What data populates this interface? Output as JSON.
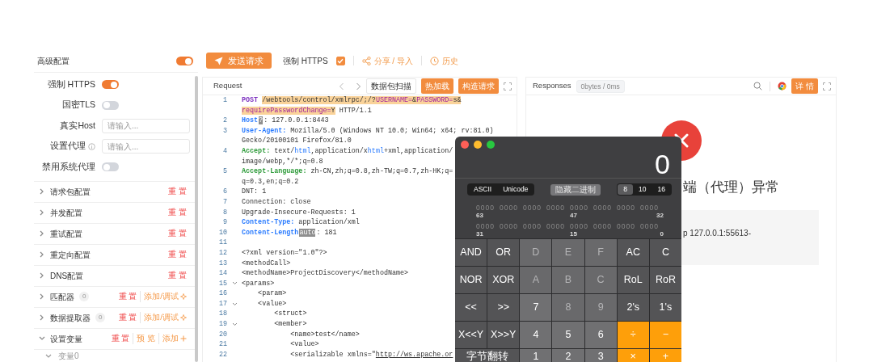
{
  "sidebar": {
    "title": "高级配置",
    "enabled": true,
    "fields": [
      {
        "kind": "toggle",
        "label": "强制 HTTPS",
        "on": true
      },
      {
        "kind": "toggle",
        "label": "国密TLS",
        "on": false
      },
      {
        "kind": "input",
        "label": "真实Host",
        "placeholder": "请输入..."
      },
      {
        "kind": "input",
        "label": "设置代理",
        "hint_icon": true,
        "placeholder": "请输入..."
      },
      {
        "kind": "toggle",
        "label": "禁用系统代理",
        "on": false
      }
    ],
    "sections": [
      {
        "label": "请求包配置",
        "expanded": false,
        "actions": [
          {
            "kind": "reset",
            "label": "重 置"
          }
        ]
      },
      {
        "label": "并发配置",
        "expanded": false,
        "actions": [
          {
            "kind": "reset",
            "label": "重 置"
          }
        ]
      },
      {
        "label": "重试配置",
        "expanded": false,
        "actions": [
          {
            "kind": "reset",
            "label": "重 置"
          }
        ]
      },
      {
        "label": "重定向配置",
        "expanded": false,
        "actions": [
          {
            "kind": "reset",
            "label": "重 置"
          }
        ]
      },
      {
        "label": "DNS配置",
        "expanded": false,
        "actions": [
          {
            "kind": "reset",
            "label": "重 置"
          }
        ]
      },
      {
        "label": "匹配器",
        "count": "0",
        "expanded": false,
        "actions": [
          {
            "kind": "reset",
            "label": "重 置"
          },
          {
            "kind": "debug",
            "label": "添加/调试"
          }
        ]
      },
      {
        "label": "数据提取器",
        "count": "0",
        "expanded": false,
        "actions": [
          {
            "kind": "reset",
            "label": "重 置"
          },
          {
            "kind": "debug",
            "label": "添加/调试"
          }
        ]
      },
      {
        "label": "设置变量",
        "expanded": true,
        "actions": [
          {
            "kind": "reset",
            "label": "重 置"
          },
          {
            "kind": "preview",
            "label": "预 览"
          },
          {
            "kind": "add",
            "label": "添加"
          }
        ],
        "children": [
          {
            "label": "变量0",
            "expanded": true
          }
        ]
      }
    ]
  },
  "toolbar": {
    "send_button": "发送请求",
    "force_https": {
      "label": "强制 HTTPS",
      "checked": true
    },
    "share": "分享 / 导入",
    "history": "历史"
  },
  "request": {
    "title": "Request",
    "scan_button": "数据包扫描",
    "buttons": [
      "热加载",
      "构造请求"
    ],
    "lines": [
      {
        "number": "1",
        "rows": [
          {
            "segments": [
              {
                "text": "POST ",
                "kind": "method"
              },
              {
                "text": "/webtools/control/xmlrpc/;/?",
                "kind": "mark"
              },
              {
                "text": "USERNAME=",
                "kind": "param"
              },
              {
                "text": "&",
                "kind": "mark"
              },
              {
                "text": "PASSWORD=",
                "kind": "param"
              },
              {
                "text": "s&",
                "kind": "mark"
              }
            ]
          },
          {
            "segments": [
              {
                "text": "requirePasswordChange=",
                "kind": "param"
              },
              {
                "text": "Y",
                "kind": "mark"
              },
              {
                "text": " HTTP/1.1"
              }
            ]
          }
        ]
      },
      {
        "number": "2",
        "rows": [
          {
            "segments": [
              {
                "text": "Host",
                "kind": "key"
              },
              {
                "text": "?",
                "kind": "hint"
              },
              {
                "text": ": 127.0.0.1:8443"
              }
            ]
          }
        ]
      },
      {
        "number": "3",
        "rows": [
          {
            "segments": [
              {
                "text": "User-Agent:",
                "kind": "key"
              },
              {
                "text": " Mozilla/5.0 (Windows NT 10.0; Win64; x64; rv:81.0)"
              }
            ]
          },
          {
            "segments": [
              {
                "text": "Gecko/20100101 Firefox/81.0"
              }
            ]
          }
        ]
      },
      {
        "number": "4",
        "rows": [
          {
            "segments": [
              {
                "text": "Accept:",
                "kind": "accept"
              },
              {
                "text": " text/"
              },
              {
                "text": "html",
                "kind": "type"
              },
              {
                "text": ",application/x"
              },
              {
                "text": "html",
                "kind": "type"
              },
              {
                "text": "+xml,application/"
              }
            ]
          },
          {
            "segments": [
              {
                "text": "image/webp,*/*;q=0.8"
              }
            ]
          }
        ]
      },
      {
        "number": "5",
        "rows": [
          {
            "segments": [
              {
                "text": "Accept-Language:",
                "kind": "accept"
              },
              {
                "text": " zh-CN,zh;q=0.8,zh-TW;q=0.7,zh-HK;q="
              }
            ]
          },
          {
            "segments": [
              {
                "text": "q=0.3,en;q=0.2"
              }
            ]
          }
        ]
      },
      {
        "number": "6",
        "rows": [
          {
            "segments": [
              {
                "text": "DNT: 1"
              }
            ]
          }
        ]
      },
      {
        "number": "7",
        "rows": [
          {
            "segments": [
              {
                "text": "Connection: close"
              }
            ]
          }
        ]
      },
      {
        "number": "8",
        "rows": [
          {
            "segments": [
              {
                "text": "Upgrade-Insecure-Requests: 1"
              }
            ]
          }
        ]
      },
      {
        "number": "9",
        "rows": [
          {
            "segments": [
              {
                "text": "Content-Type:",
                "kind": "key"
              },
              {
                "text": " application/xml"
              }
            ]
          }
        ]
      },
      {
        "number": "10",
        "rows": [
          {
            "segments": [
              {
                "text": "Content-Length",
                "kind": "key"
              },
              {
                "text": "auto",
                "kind": "hint"
              },
              {
                "text": ": 181"
              }
            ]
          }
        ]
      },
      {
        "number": "11"
      },
      {
        "number": "12",
        "rows": [
          {
            "segments": [
              {
                "text": "<?xml version=\"1.0\"?>"
              }
            ]
          }
        ]
      },
      {
        "number": "13",
        "rows": [
          {
            "segments": [
              {
                "text": "<methodCall>"
              }
            ]
          }
        ]
      },
      {
        "number": "14",
        "rows": [
          {
            "segments": [
              {
                "text": "<methodName>ProjectDiscovery</methodName>"
              }
            ]
          }
        ]
      },
      {
        "number": "15",
        "expanded": true,
        "rows": [
          {
            "segments": [
              {
                "text": "<params>"
              }
            ]
          }
        ]
      },
      {
        "number": "16",
        "rows": [
          {
            "segments": [
              {
                "text": "    <param>"
              }
            ]
          }
        ]
      },
      {
        "number": "17",
        "expanded": true,
        "rows": [
          {
            "segments": [
              {
                "text": "    <value>"
              }
            ]
          }
        ]
      },
      {
        "number": "18",
        "rows": [
          {
            "segments": [
              {
                "text": "        <struct>"
              }
            ]
          }
        ]
      },
      {
        "number": "19",
        "expanded": true,
        "rows": [
          {
            "segments": [
              {
                "text": "        <member>"
              }
            ]
          }
        ]
      },
      {
        "number": "20",
        "rows": [
          {
            "segments": [
              {
                "text": "            <name>test</name>"
              }
            ]
          }
        ]
      },
      {
        "number": "21",
        "rows": [
          {
            "segments": [
              {
                "text": "            <value>"
              }
            ]
          }
        ]
      },
      {
        "number": "22",
        "rows": [
          {
            "segments": [
              {
                "text": "            <serializable xmlns=\""
              },
              {
                "text": "http://ws.apache.or",
                "kind": "link"
              }
            ]
          }
        ]
      }
    ]
  },
  "response": {
    "title": "Responses",
    "stats": "0bytes / 0ms",
    "detail_button": "详 情",
    "error_title": "端（代理）异常",
    "error_detail": "p 127.0.0.1:55613-"
  },
  "calculator": {
    "display": "0",
    "encodings": [
      {
        "label": "ASCII",
        "selected": false
      },
      {
        "label": "Unicode",
        "selected": false
      }
    ],
    "hide_binary": "隐藏二进制",
    "bases": [
      {
        "label": "8",
        "selected": true
      },
      {
        "label": "10",
        "selected": false
      },
      {
        "label": "16",
        "selected": false
      }
    ],
    "bit_rows": [
      {
        "bits": "0000 0000 0000 0000 0000 0000 0000 0000",
        "marks": [
          "63",
          "47",
          "32"
        ]
      },
      {
        "bits": "0000 0000 0000 0000 0000 0000 0000 0000",
        "marks": [
          "31",
          "15",
          "0"
        ]
      }
    ],
    "keys": [
      [
        {
          "label": "AND",
          "kind": "fn"
        },
        {
          "label": "OR",
          "kind": "fn"
        },
        {
          "label": "D",
          "kind": "off"
        },
        {
          "label": "E",
          "kind": "off"
        },
        {
          "label": "F",
          "kind": "off"
        },
        {
          "label": "AC",
          "kind": "fn"
        },
        {
          "label": "C",
          "kind": "fn"
        }
      ],
      [
        {
          "label": "NOR",
          "kind": "fn"
        },
        {
          "label": "XOR",
          "kind": "fn"
        },
        {
          "label": "A",
          "kind": "off"
        },
        {
          "label": "B",
          "kind": "off"
        },
        {
          "label": "C",
          "kind": "off"
        },
        {
          "label": "RoL",
          "kind": "fn"
        },
        {
          "label": "RoR",
          "kind": "fn"
        }
      ],
      [
        {
          "label": "<<",
          "kind": "fn"
        },
        {
          "label": ">>",
          "kind": "fn"
        },
        {
          "label": "7",
          "kind": "digit"
        },
        {
          "label": "8",
          "kind": "off"
        },
        {
          "label": "9",
          "kind": "off"
        },
        {
          "label": "2's",
          "kind": "fn"
        },
        {
          "label": "1's",
          "kind": "fn"
        }
      ],
      [
        {
          "label": "X<<Y",
          "kind": "fn"
        },
        {
          "label": "X>>Y",
          "kind": "fn"
        },
        {
          "label": "4",
          "kind": "digit"
        },
        {
          "label": "5",
          "kind": "digit"
        },
        {
          "label": "6",
          "kind": "digit"
        },
        {
          "label": "÷",
          "kind": "op"
        },
        {
          "label": "−",
          "kind": "op"
        }
      ],
      [
        {
          "label": "字节翻转",
          "kind": "wide"
        },
        {
          "label": "1",
          "kind": "digit"
        },
        {
          "label": "2",
          "kind": "digit"
        },
        {
          "label": "3",
          "kind": "digit"
        },
        {
          "label": "×",
          "kind": "op"
        },
        {
          "label": "+",
          "kind": "op"
        }
      ]
    ]
  }
}
